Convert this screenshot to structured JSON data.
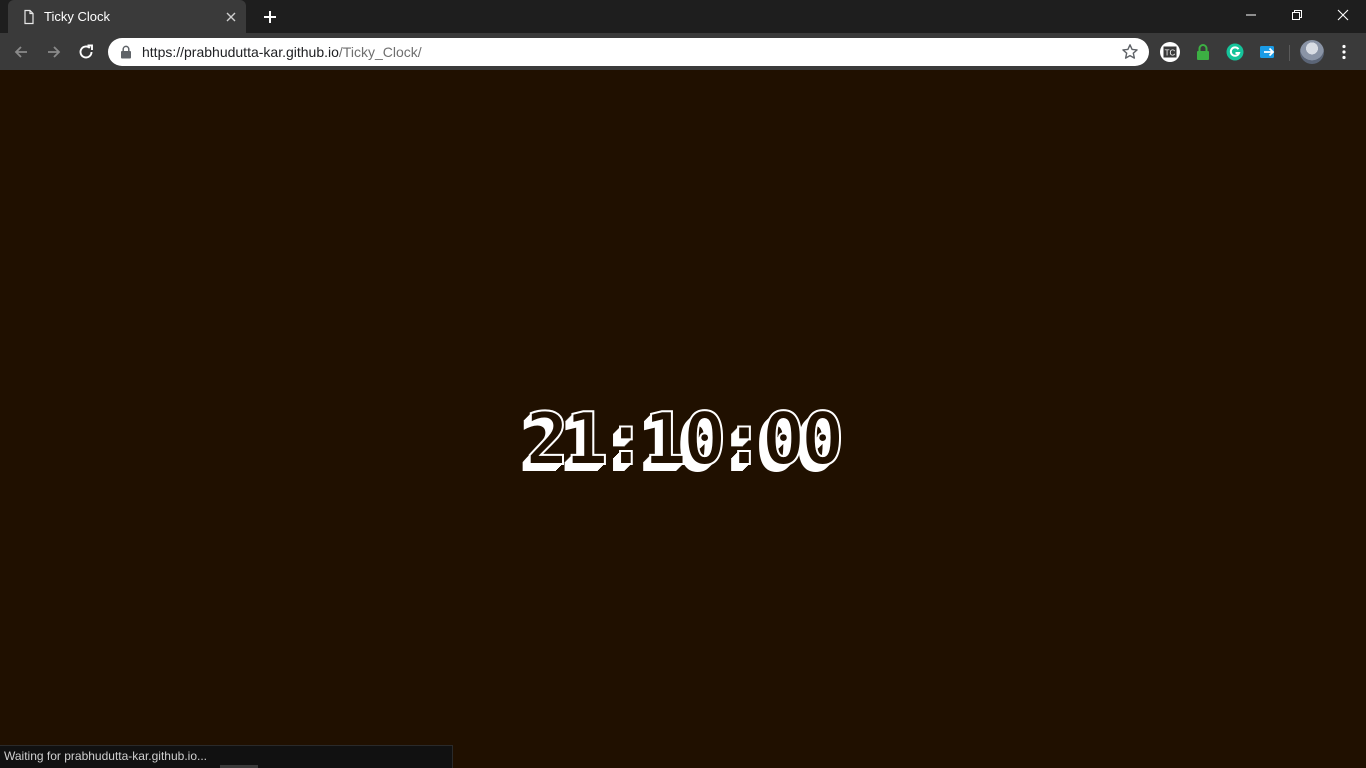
{
  "browser": {
    "tab": {
      "title": "Ticky Clock",
      "icon": "page-icon"
    },
    "address": {
      "host": "https://prabhudutta-kar.github.io",
      "path": "/Ticky_Clock/"
    },
    "extensions": [
      {
        "name": "tc-extension-icon",
        "text": "TC"
      },
      {
        "name": "lock-extension-icon"
      },
      {
        "name": "grammarly-icon"
      },
      {
        "name": "send-extension-icon"
      }
    ],
    "colors": {
      "tab_strip": "#1e1e1e",
      "toolbar": "#3a3a3a",
      "grammarly": "#15c39a",
      "lock_ext": "#3cb043",
      "send_ext": "#1a9be6"
    }
  },
  "page": {
    "clock_time": "21:10:00",
    "background": "#201000",
    "digit_color": "#ffffff"
  },
  "status_bar": {
    "text": "Waiting for prabhudutta-kar.github.io..."
  }
}
